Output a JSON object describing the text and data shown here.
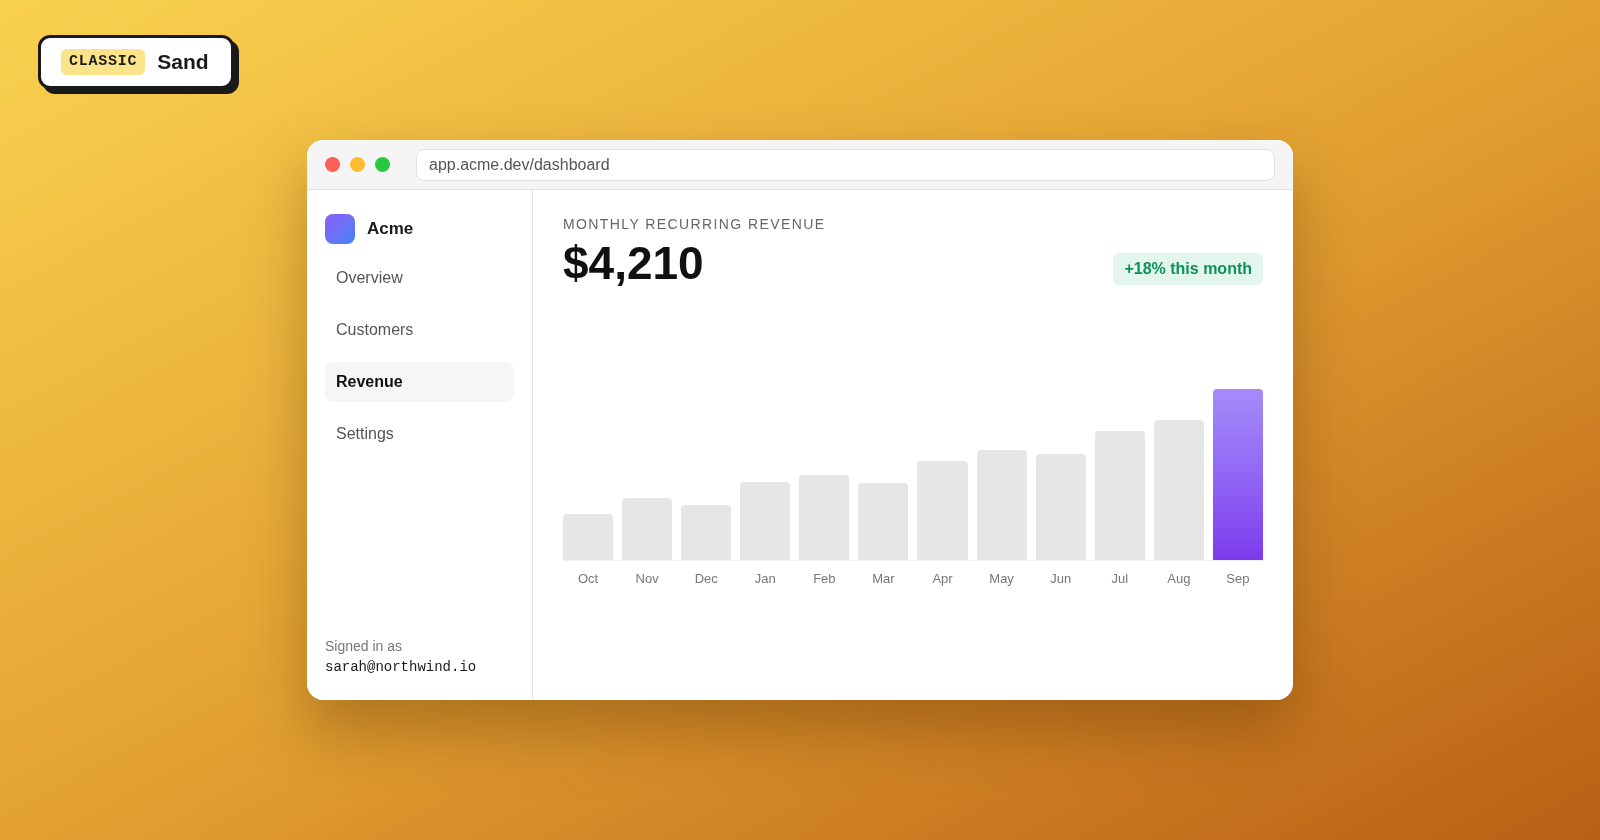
{
  "badge": {
    "tag": "CLASSIC",
    "label": "Sand"
  },
  "window": {
    "url": "app.acme.dev/dashboard"
  },
  "sidebar": {
    "brand": "Acme",
    "items": [
      {
        "label": "Overview",
        "selected": false
      },
      {
        "label": "Customers",
        "selected": false
      },
      {
        "label": "Revenue",
        "selected": true
      },
      {
        "label": "Settings",
        "selected": false
      }
    ],
    "signed_in_label": "Signed in as",
    "email": "sarah@northwind.io"
  },
  "main": {
    "title": "MONTHLY RECURRING REVENUE",
    "value": "$4,210",
    "change": "+18% this month",
    "months": [
      {
        "label": "Oct",
        "selected": false
      },
      {
        "label": "Nov",
        "selected": false
      },
      {
        "label": "Dec",
        "selected": false
      },
      {
        "label": "Jan",
        "selected": false
      },
      {
        "label": "Feb",
        "selected": false
      },
      {
        "label": "Mar",
        "selected": false
      },
      {
        "label": "Apr",
        "selected": false
      },
      {
        "label": "May",
        "selected": false
      },
      {
        "label": "Jun",
        "selected": false
      },
      {
        "label": "Jul",
        "selected": false
      },
      {
        "label": "Aug",
        "selected": false
      },
      {
        "label": "Sep",
        "selected": true
      }
    ]
  }
}
